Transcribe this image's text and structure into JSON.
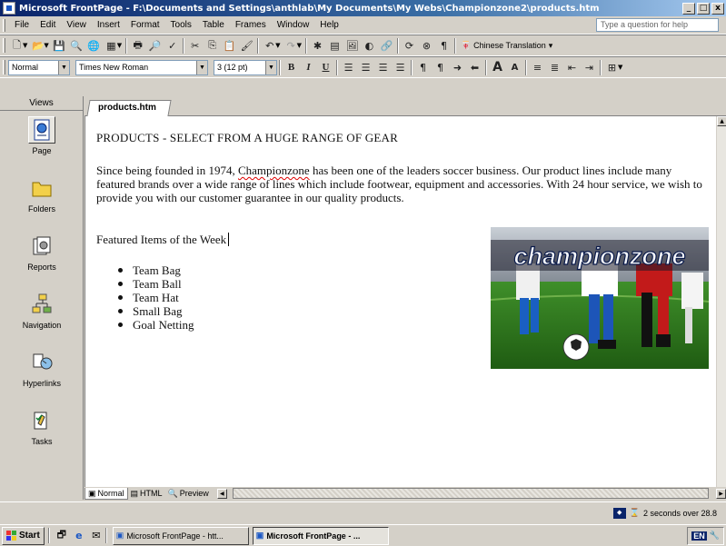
{
  "window": {
    "title": "Microsoft FrontPage - F:\\Documents and Settings\\anthlab\\My Documents\\My Webs\\Championzone2\\products.htm",
    "buttons": [
      "_",
      "□",
      "x"
    ]
  },
  "menubar": {
    "items": [
      "File",
      "Edit",
      "View",
      "Insert",
      "Format",
      "Tools",
      "Table",
      "Frames",
      "Window",
      "Help"
    ],
    "help_placeholder": "Type a question for help"
  },
  "toolbar": {
    "style_value": "Normal",
    "font_value": "Times New Roman",
    "size_value": "3 (12 pt)",
    "translation_label": "Chinese Translation"
  },
  "views": {
    "header": "Views",
    "items": [
      "Page",
      "Folders",
      "Reports",
      "Navigation",
      "Hyperlinks",
      "Tasks"
    ]
  },
  "document": {
    "tab_label": "products.htm",
    "heading": "PRODUCTS - SELECT FROM A HUGE RANGE OF GEAR",
    "intro_before": "Since being founded in 1974, ",
    "intro_brand": "Championzone",
    "intro_after": " has been one of the leaders soccer business. Our product lines include many featured brands over a wide range of lines which include footwear, equipment and accessories. With 24 hour service, we wish to provide you with our customer guarantee in our quality products.",
    "featured_title": "Featured Items of the Week",
    "items": [
      "Team Bag",
      "Team Ball",
      "Team Hat",
      "Small Bag",
      "Goal Netting"
    ],
    "image_logo_text": "championzone"
  },
  "view_tabs": [
    "Normal",
    "HTML",
    "Preview"
  ],
  "status": {
    "download_time": "2 seconds over 28.8"
  },
  "taskbar": {
    "start_label": "Start",
    "tasks": [
      "Microsoft FrontPage - htt...",
      "Microsoft FrontPage - ..."
    ],
    "tray_lang": "EN"
  }
}
